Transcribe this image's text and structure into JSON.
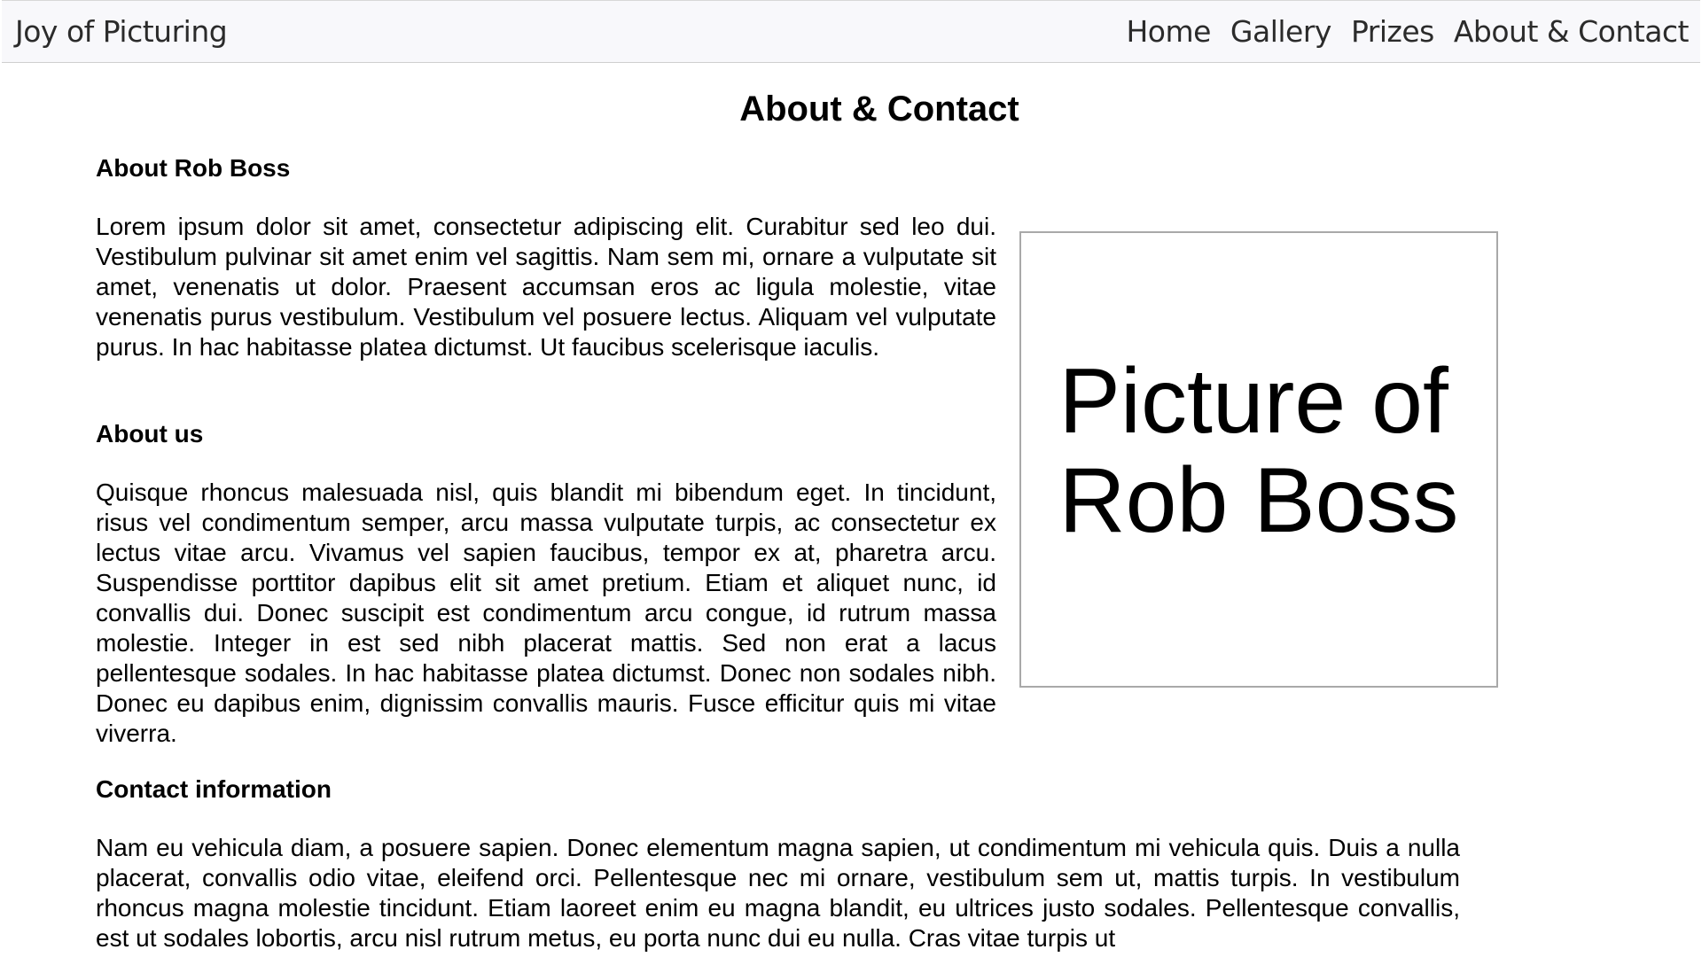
{
  "nav": {
    "brand": "Joy of Picturing",
    "links": [
      "Home",
      "Gallery",
      "Prizes",
      "About & Contact"
    ]
  },
  "page": {
    "title": "About & Contact"
  },
  "sections": {
    "about_rob": {
      "heading": "About Rob Boss",
      "text": "Lorem ipsum dolor sit amet, consectetur adipiscing elit. Curabitur sed leo dui. Vestibulum pulvinar sit amet enim vel sagittis. Nam sem mi, ornare a vulputate sit amet, venenatis ut dolor. Praesent accumsan eros ac ligula molestie, vitae venenatis purus vestibulum. Vestibulum vel posuere lectus. Aliquam vel vulputate purus. In hac habitasse platea dictumst. Ut faucibus scelerisque iaculis."
    },
    "about_us": {
      "heading": "About us",
      "text": "Quisque rhoncus malesuada nisl, quis blandit mi bibendum eget. In tincidunt, risus vel condimentum semper, arcu massa vulputate turpis, ac consectetur ex lectus vitae arcu. Vivamus vel sapien faucibus, tempor ex at, pharetra arcu. Suspendisse porttitor dapibus elit sit amet pretium. Etiam et aliquet nunc, id convallis dui. Donec suscipit est condimentum arcu congue, id rutrum massa molestie. Integer in est sed nibh placerat mattis. Sed non erat a lacus pellentesque sodales. In hac habitasse platea dictumst. Donec non sodales nibh. Donec eu dapibus enim, dignissim convallis mauris. Fusce efficitur quis mi vitae viverra."
    },
    "contact": {
      "heading": "Contact information",
      "text": "Nam eu vehicula diam, a posuere sapien. Donec elementum magna sapien, ut condimentum mi vehicula quis. Duis a nulla placerat, convallis odio vitae, eleifend orci. Pellentesque nec mi ornare, vestibulum sem ut, mattis turpis. In vestibulum rhoncus magna molestie tincidunt. Etiam laoreet enim eu magna blandit, eu ultrices justo sodales. Pellentesque convallis, est ut sodales lobortis, arcu nisl rutrum metus, eu porta nunc dui eu nulla. Cras vitae turpis ut"
    }
  },
  "photo": {
    "line1": "Picture of",
    "line2": "Rob Boss"
  }
}
